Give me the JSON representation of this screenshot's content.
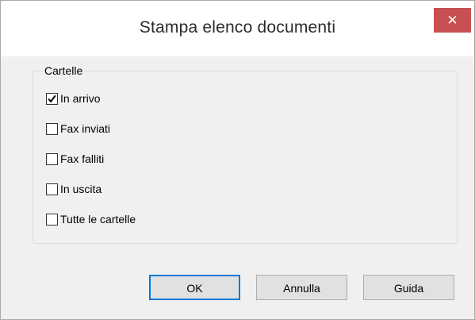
{
  "window": {
    "title": "Stampa elenco documenti",
    "close_glyph": "✕"
  },
  "group": {
    "label": "Cartelle",
    "options": [
      {
        "label": "In arrivo",
        "checked": true
      },
      {
        "label": "Fax inviati",
        "checked": false
      },
      {
        "label": "Fax falliti",
        "checked": false
      },
      {
        "label": "In uscita",
        "checked": false
      },
      {
        "label": "Tutte le cartelle",
        "checked": false
      }
    ]
  },
  "buttons": {
    "ok_label": "OK",
    "cancel_label": "Annulla",
    "help_label": "Guida"
  },
  "colors": {
    "close_button": "#c75050",
    "default_button_border": "#0078d7",
    "dialog_background": "#f0f0f0"
  }
}
